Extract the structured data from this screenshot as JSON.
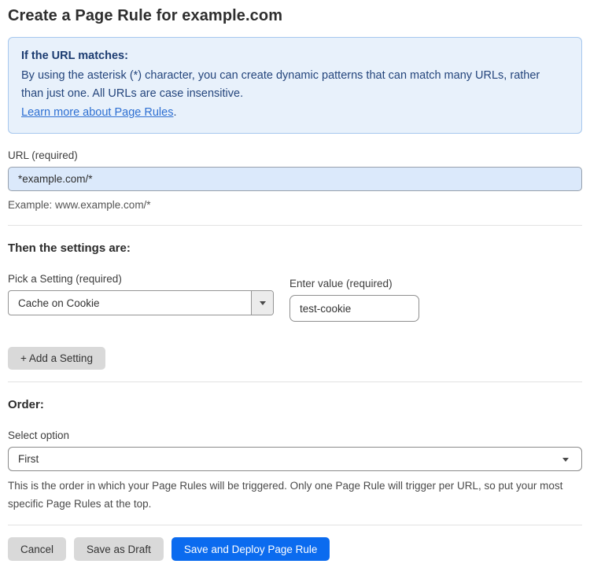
{
  "page": {
    "title": "Create a Page Rule for example.com"
  },
  "info_banner": {
    "heading": "If the URL matches:",
    "body": "By using the asterisk (*) character, you can create dynamic patterns that can match many URLs, rather than just one. All URLs are case insensitive.",
    "link_label": "Learn more about Page Rules",
    "link_suffix": "."
  },
  "url_field": {
    "label": "URL (required)",
    "value": "*example.com/*",
    "helper": "Example: www.example.com/*"
  },
  "settings_section": {
    "heading": "Then the settings are:",
    "setting_label": "Pick a Setting (required)",
    "setting_selected": "Cache on Cookie",
    "value_label": "Enter value (required)",
    "value_text": "test-cookie",
    "add_setting_label": "+ Add a Setting"
  },
  "order_section": {
    "heading": "Order:",
    "select_label": "Select option",
    "selected_option": "First",
    "helper": "This is the order in which your Page Rules will be triggered. Only one Page Rule will trigger per URL, so put your most specific Page Rules at the top."
  },
  "actions": {
    "cancel_label": "Cancel",
    "save_draft_label": "Save as Draft",
    "save_deploy_label": "Save and Deploy Page Rule"
  },
  "colors": {
    "accent_blue": "#0b6bef",
    "banner_bg": "#e8f1fb",
    "banner_border": "#a6c7ee",
    "banner_text": "#24457c",
    "link_blue": "#2d6fd2",
    "highlight_input_bg": "#dbe9fb",
    "button_gray": "#d9d9d9"
  }
}
